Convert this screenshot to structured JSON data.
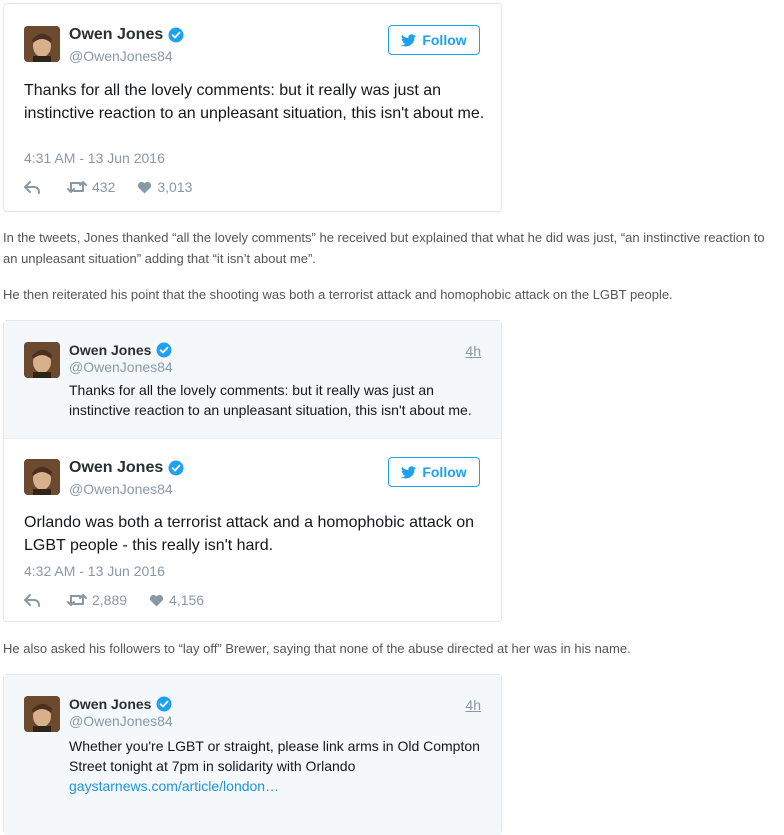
{
  "tweet1": {
    "author": "Owen Jones",
    "handle": "@OwenJones84",
    "follow_label": "Follow",
    "text": "Thanks for all the lovely comments: but it really was just an instinctive reaction to an unpleasant situation, this isn't about me.",
    "timestamp": "4:31 AM - 13 Jun 2016",
    "retweets": "432",
    "likes": "3,013"
  },
  "para1": "In the tweets, Jones thanked “all the lovely comments” he received but explained that what he did was just, “an instinctive reaction to an unpleasant situation” adding that “it isn’t about me”.",
  "para2": "He then reiterated his point that the shooting was both a terrorist attack and homophobic attack on the LGBT people.",
  "tweet2": {
    "quote": {
      "author": "Owen Jones",
      "handle": "@OwenJones84",
      "time": "4h",
      "text": "Thanks for all the lovely comments: but it really was just an instinctive reaction to an unpleasant situation, this isn't about me."
    },
    "author": "Owen Jones",
    "handle": "@OwenJones84",
    "follow_label": "Follow",
    "text": "Orlando was both a terrorist attack and a homophobic attack on LGBT people - this really isn't hard.",
    "timestamp": "4:32 AM - 13 Jun 2016",
    "retweets": "2,889",
    "likes": "4,156"
  },
  "para3": "He also asked his followers to “lay off” Brewer, saying that none of the abuse directed at her was in his name.",
  "tweet3": {
    "quote": {
      "author": "Owen Jones",
      "handle": "@OwenJones84",
      "time": "4h",
      "text": "Whether you're LGBT or straight, please link arms in Old Compton Street tonight at 7pm in solidarity with Orlando",
      "link": "gaystarnews.com/article/london…"
    }
  },
  "colors": {
    "accent": "#1da1f2",
    "verified": "#1da1f2",
    "muted": "#8899a6",
    "link": "#1b95e0"
  },
  "icons": [
    "verified-badge-icon",
    "twitter-bird-icon",
    "reply-icon",
    "retweet-icon",
    "heart-icon"
  ]
}
